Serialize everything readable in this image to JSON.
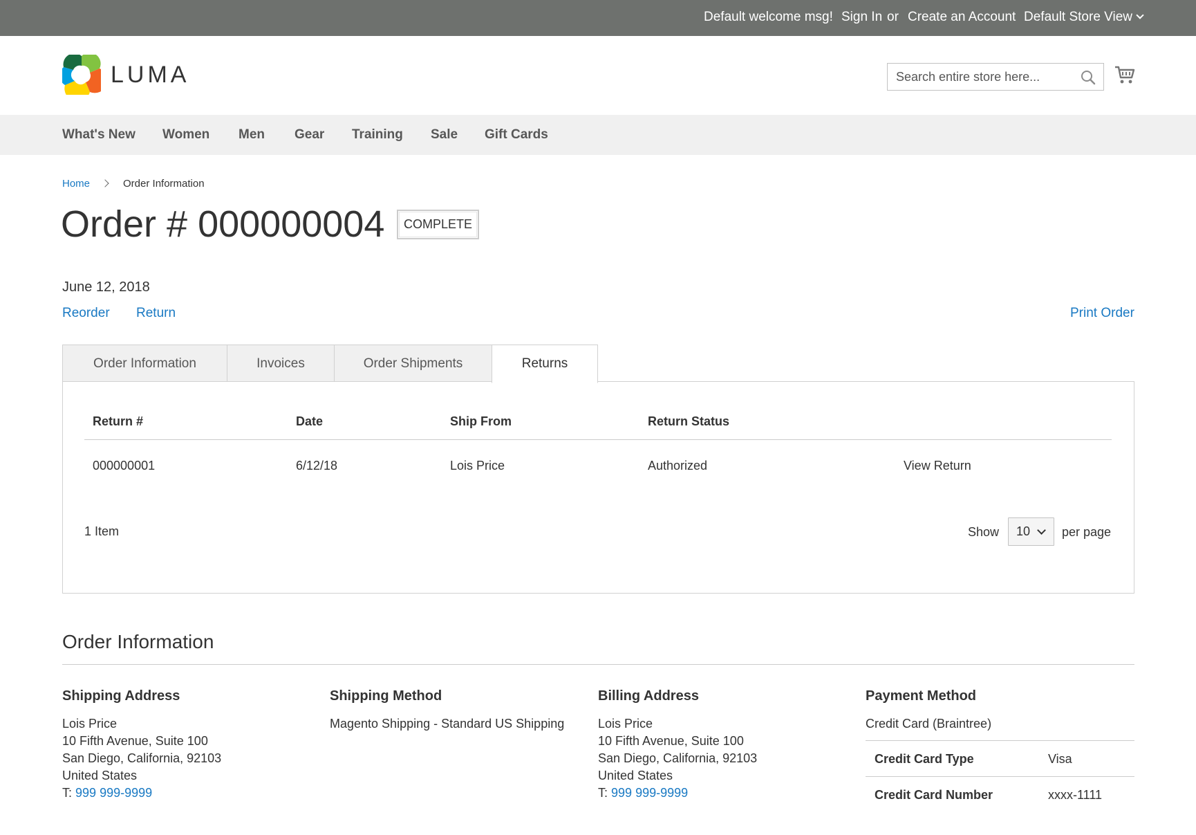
{
  "panel_header": {
    "welcome": "Default welcome msg!",
    "sign_in": "Sign In",
    "or": "or",
    "create_account": "Create an Account",
    "store_view": "Default Store View"
  },
  "header": {
    "logo_text": "LUMA",
    "search_placeholder": "Search entire store here...",
    "search_icon": "search-icon",
    "cart_icon": "cart-icon"
  },
  "nav": [
    "What's New",
    "Women",
    "Men",
    "Gear",
    "Training",
    "Sale",
    "Gift Cards"
  ],
  "breadcrumbs": {
    "home": "Home",
    "current": "Order Information"
  },
  "order": {
    "title": "Order # 000000004",
    "status": "COMPLETE",
    "date": "June 12, 2018",
    "actions": {
      "reorder": "Reorder",
      "return": "Return",
      "print": "Print Order"
    }
  },
  "tabs": [
    {
      "label": "Order Information",
      "active": false
    },
    {
      "label": "Invoices",
      "active": false
    },
    {
      "label": "Order Shipments",
      "active": false
    },
    {
      "label": "Returns",
      "active": true
    }
  ],
  "returns_table": {
    "headers": [
      "Return #",
      "Date",
      "Ship From",
      "Return Status"
    ],
    "rows": [
      {
        "return_no": "000000001",
        "date": "6/12/18",
        "ship_from": "Lois Price",
        "status": "Authorized",
        "action": "View Return"
      }
    ],
    "toolbar": {
      "amount": "1 Item",
      "show_label": "Show",
      "limit": "10",
      "per_page": "per page"
    }
  },
  "order_information": {
    "title": "Order Information",
    "shipping_address": {
      "title": "Shipping Address",
      "name": "Lois Price",
      "street": "10 Fifth Avenue, Suite 100",
      "city_line": "San Diego, California, 92103",
      "country": "United States",
      "phone_prefix": "T:",
      "phone": "999 999-9999"
    },
    "shipping_method": {
      "title": "Shipping Method",
      "value": "Magento Shipping - Standard US Shipping"
    },
    "billing_address": {
      "title": "Billing Address",
      "name": "Lois Price",
      "street": "10 Fifth Avenue, Suite 100",
      "city_line": "San Diego, California, 92103",
      "country": "United States",
      "phone_prefix": "T:",
      "phone": "999 999-9999"
    },
    "payment_method": {
      "title": "Payment Method",
      "value": "Credit Card (Braintree)",
      "rows": [
        {
          "label": "Credit Card Type",
          "value": "Visa"
        },
        {
          "label": "Credit Card Number",
          "value": "xxxx-1111"
        }
      ]
    }
  },
  "colors": {
    "panel_bg": "#6e716e",
    "nav_bg": "#f0f0f0",
    "link": "#1979c3",
    "text": "#333333"
  }
}
